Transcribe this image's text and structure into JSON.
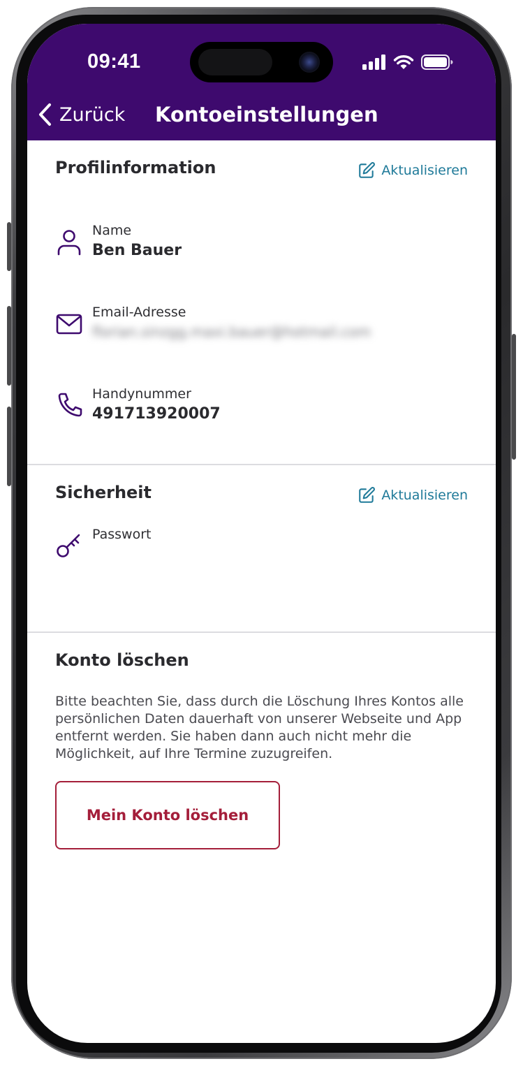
{
  "status_bar": {
    "time": "09:41",
    "icons": [
      "cellular-signal-icon",
      "wifi-icon",
      "battery-icon"
    ]
  },
  "header": {
    "back_label": "Zurück",
    "title": "Kontoeinstellungen",
    "background_color": "#3e0a6e"
  },
  "profile": {
    "title": "Profilinformation",
    "edit_label": "Aktualisieren",
    "fields": [
      {
        "icon": "person-icon",
        "label": "Name",
        "value": "Ben Bauer"
      },
      {
        "icon": "mail-icon",
        "label": "Email-Adresse",
        "value": "florian.sinzgg.maxi.bauer@hotmail.com"
      },
      {
        "icon": "phone-icon",
        "label": "Handynummer",
        "value": "491713920007"
      }
    ]
  },
  "security": {
    "title": "Sicherheit",
    "edit_label": "Aktualisieren",
    "fields": [
      {
        "icon": "key-icon",
        "label": "Passwort"
      }
    ]
  },
  "delete_account": {
    "title": "Konto löschen",
    "text": "Bitte beachten Sie, dass durch die Löschung Ihres Kontos alle persönlichen Daten dauerhaft von unserer Webseite und App entfernt werden. Sie haben dann auch nicht mehr die Möglichkeit, auf Ihre Termine zuzugreifen.",
    "button_label": "Mein Konto löschen",
    "accent_color": "#a41e3a"
  },
  "colors": {
    "link": "#1f7a99",
    "icon": "#3e0a6e"
  }
}
